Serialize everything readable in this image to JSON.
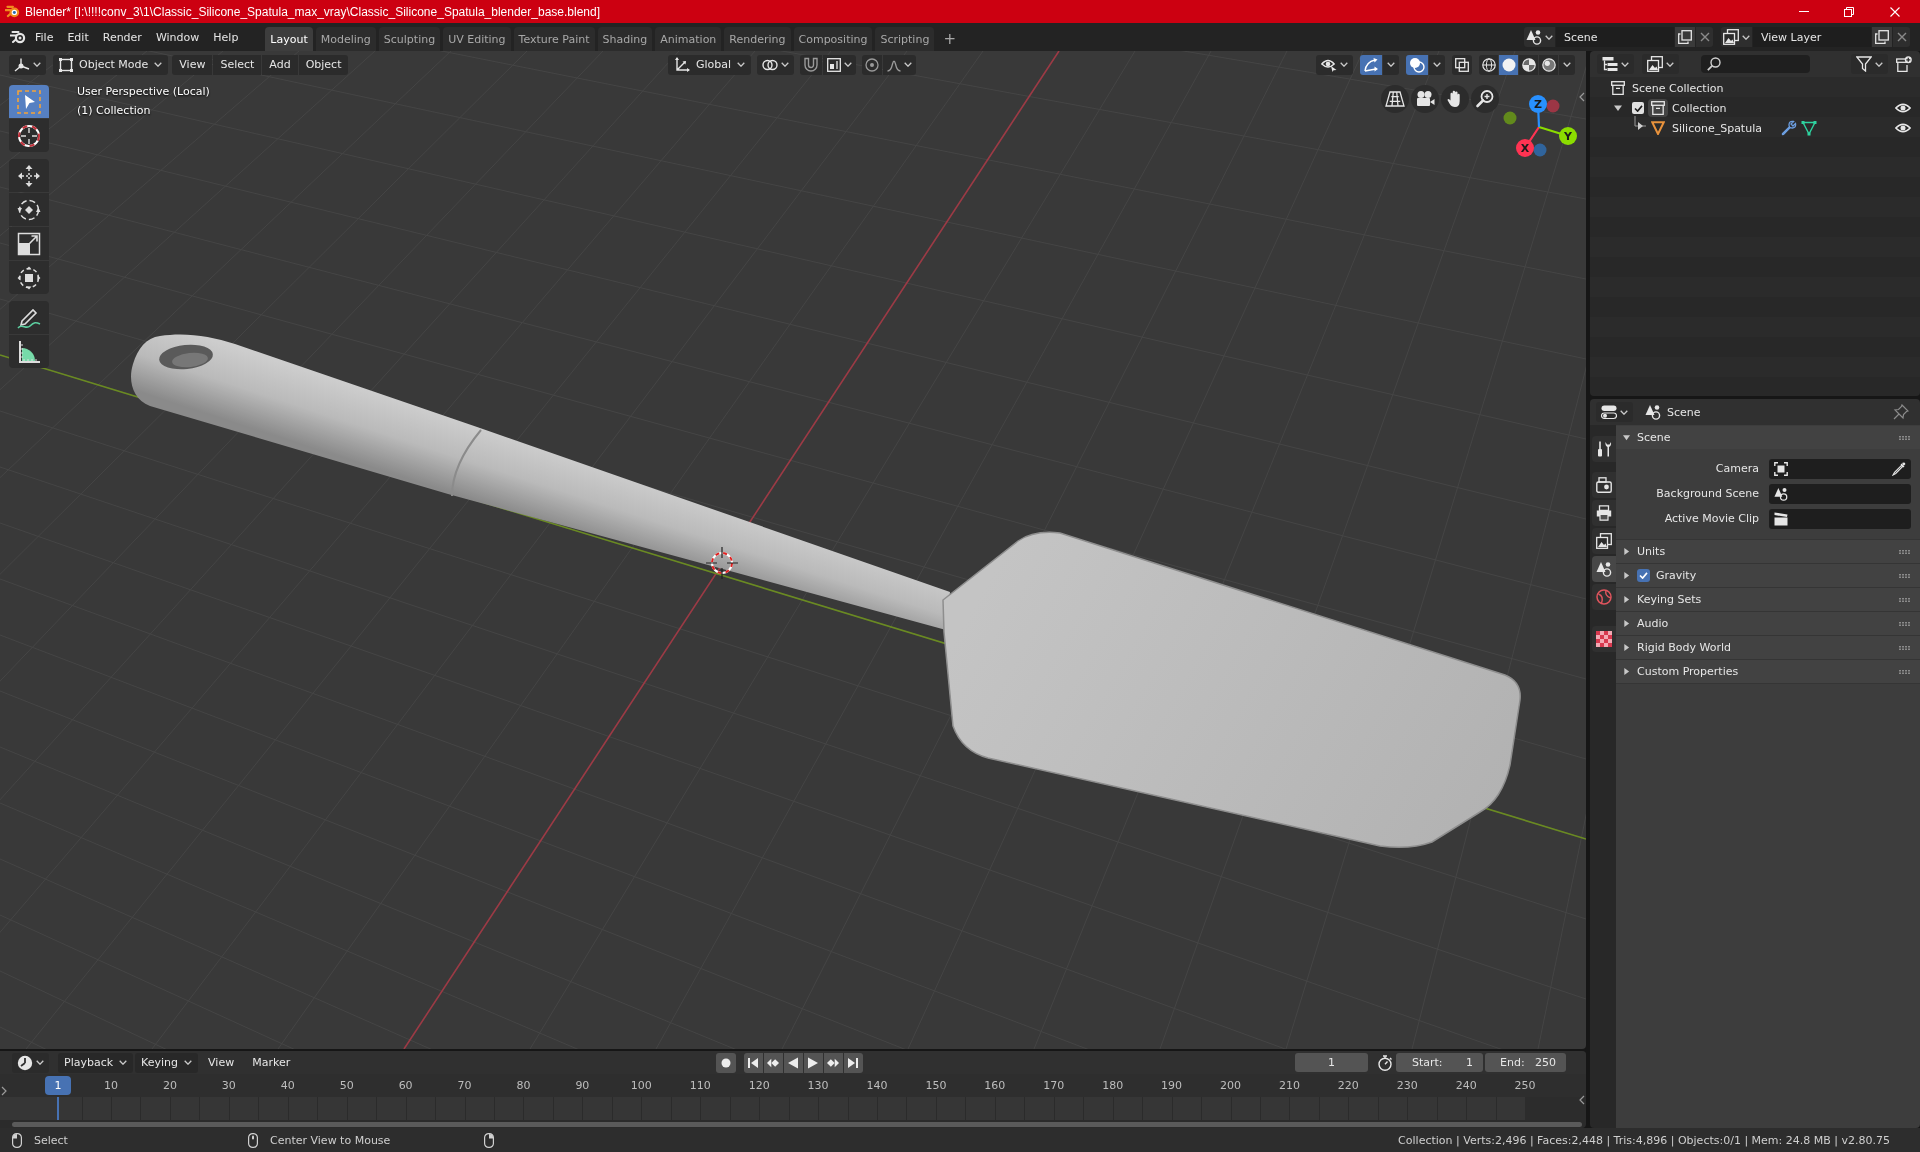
{
  "title_bar": {
    "title": "Blender* [I:\\!!!!conv_3\\1\\Classic_Silicone_Spatula_max_vray\\Classic_Silicone_Spatula_blender_base.blend]"
  },
  "top_bar": {
    "menus": [
      "File",
      "Edit",
      "Render",
      "Window",
      "Help"
    ],
    "workspaces": [
      {
        "label": "Layout",
        "selected": true
      },
      {
        "label": "Modeling",
        "selected": false
      },
      {
        "label": "Sculpting",
        "selected": false
      },
      {
        "label": "UV Editing",
        "selected": false
      },
      {
        "label": "Texture Paint",
        "selected": false
      },
      {
        "label": "Shading",
        "selected": false
      },
      {
        "label": "Animation",
        "selected": false
      },
      {
        "label": "Rendering",
        "selected": false
      },
      {
        "label": "Compositing",
        "selected": false
      },
      {
        "label": "Scripting",
        "selected": false
      }
    ],
    "add_workspace": "+",
    "scene": "Scene",
    "view_layer": "View Layer"
  },
  "viewport": {
    "mode": "Object Mode",
    "menus": [
      "View",
      "Select",
      "Add",
      "Object"
    ],
    "orientation": "Global",
    "gizmos_on": true,
    "overlays_on": true,
    "xray_on": false,
    "shading": [
      {
        "kind": "wireframe",
        "selected": false
      },
      {
        "kind": "solid",
        "selected": true
      },
      {
        "kind": "material",
        "selected": false
      },
      {
        "kind": "rendered",
        "selected": false
      }
    ],
    "tool_groups": [
      [
        {
          "kind": "select_box",
          "selected": true
        },
        {
          "kind": "cursor",
          "selected": false
        }
      ],
      [
        {
          "kind": "move",
          "selected": false
        },
        {
          "kind": "rotate",
          "selected": false
        },
        {
          "kind": "scale",
          "selected": false
        },
        {
          "kind": "transform",
          "selected": false
        }
      ],
      [
        {
          "kind": "annotate",
          "selected": false
        },
        {
          "kind": "measure",
          "selected": false
        }
      ]
    ],
    "info": [
      "User Perspective (Local)",
      "(1) Collection"
    ],
    "gizmo_axes": [
      {
        "label": "X",
        "color": "#ff3352"
      },
      {
        "label": "Y",
        "color": "#8bdc00"
      },
      {
        "label": "Z",
        "color": "#2890ff"
      }
    ]
  },
  "outliner": {
    "tree": [
      {
        "label": "Scene Collection",
        "kind": "scene_collection",
        "active": false,
        "children": [
          {
            "label": "Collection",
            "kind": "collection",
            "active": true,
            "expanded": true,
            "checked": true,
            "visible": true,
            "children": [
              {
                "label": "Silicone_Spatula",
                "kind": "mesh_object",
                "active": false,
                "expanded": false,
                "visible": true
              }
            ]
          }
        ]
      }
    ]
  },
  "properties": {
    "title": "Scene",
    "tab_groups": [
      [
        {
          "kind": "tool",
          "selected": false
        }
      ],
      [
        {
          "kind": "render",
          "selected": false
        },
        {
          "kind": "output",
          "selected": false
        },
        {
          "kind": "view_layer",
          "selected": false
        },
        {
          "kind": "scene",
          "selected": true
        },
        {
          "kind": "world",
          "selected": false
        }
      ],
      [
        {
          "kind": "texture",
          "selected": false
        }
      ]
    ],
    "panels": [
      {
        "label": "Scene",
        "kind": "plain",
        "expanded": true,
        "fields": [
          {
            "label": "Camera",
            "kind": "camera"
          },
          {
            "label": "Background Scene",
            "kind": "scene"
          },
          {
            "label": "Active Movie Clip",
            "kind": "movie_clip"
          }
        ]
      },
      {
        "label": "Units",
        "kind": "plain",
        "expanded": false
      },
      {
        "label": "Gravity",
        "kind": "toggle",
        "expanded": false,
        "checked": true
      },
      {
        "label": "Keying Sets",
        "kind": "plain",
        "expanded": false
      },
      {
        "label": "Audio",
        "kind": "plain",
        "expanded": false
      },
      {
        "label": "Rigid Body World",
        "kind": "plain",
        "expanded": false
      },
      {
        "label": "Custom Properties",
        "kind": "plain",
        "expanded": false
      }
    ]
  },
  "timeline": {
    "menus": [
      {
        "label": "Playback",
        "kind": "dropdown"
      },
      {
        "label": "Keying",
        "kind": "dropdown"
      },
      {
        "label": "View",
        "kind": "menu"
      },
      {
        "label": "Marker",
        "kind": "menu"
      }
    ],
    "auto_keying": false,
    "current_frame": "1",
    "start": {
      "label": "Start:",
      "value": "1"
    },
    "end": {
      "label": "End:",
      "value": "250"
    },
    "playhead": "1",
    "ruler": [
      "10",
      "20",
      "30",
      "40",
      "50",
      "60",
      "70",
      "80",
      "90",
      "100",
      "110",
      "120",
      "130",
      "140",
      "150",
      "160",
      "170",
      "180",
      "190",
      "200",
      "210",
      "220",
      "230",
      "240",
      "250"
    ]
  },
  "status_bar": {
    "hints": [
      {
        "kind": "left_click",
        "label": "Select"
      },
      {
        "kind": "middle_click",
        "label": "Center View to Mouse"
      },
      {
        "kind": "right_click"
      }
    ],
    "stats": "Collection | Verts:2,496 | Faces:2,448 | Tris:4,896 | Objects:0/1 | Mem: 24.8 MB | v2.80.75"
  }
}
